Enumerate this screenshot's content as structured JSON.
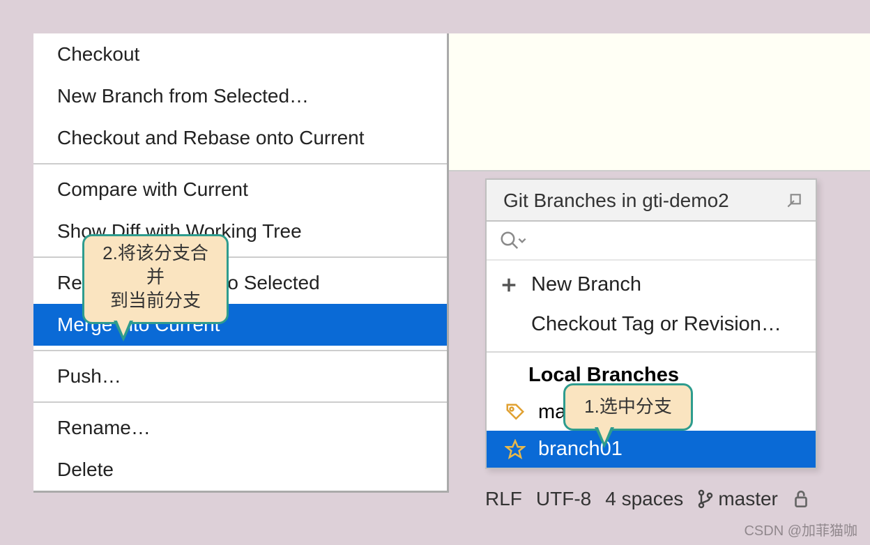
{
  "ctx": {
    "checkout": "Checkout",
    "new_branch": "New Branch from Selected…",
    "checkout_rebase": "Checkout and Rebase onto Current",
    "compare": "Compare with Current",
    "show_diff": "Show Diff with Working Tree",
    "rebase_sel": "Rebase Current onto Selected",
    "merge": "Merge into Current",
    "push": "Push…",
    "rename": "Rename…",
    "delete": "Delete"
  },
  "popup": {
    "title": "Git Branches in gti-demo2",
    "new_branch": "New Branch",
    "checkout_tag": "Checkout Tag or Revision…",
    "local_label": "Local Branches",
    "branch_master": "master",
    "branch_sel": "branch01"
  },
  "status": {
    "crlf": "RLF",
    "enc": "UTF-8",
    "indent": "4 spaces",
    "branch": "master"
  },
  "callouts": {
    "c1_line1": "2.将该分支合并",
    "c1_line2": "到当前分支",
    "c2": "1.选中分支"
  },
  "watermark": "CSDN @加菲猫咖"
}
